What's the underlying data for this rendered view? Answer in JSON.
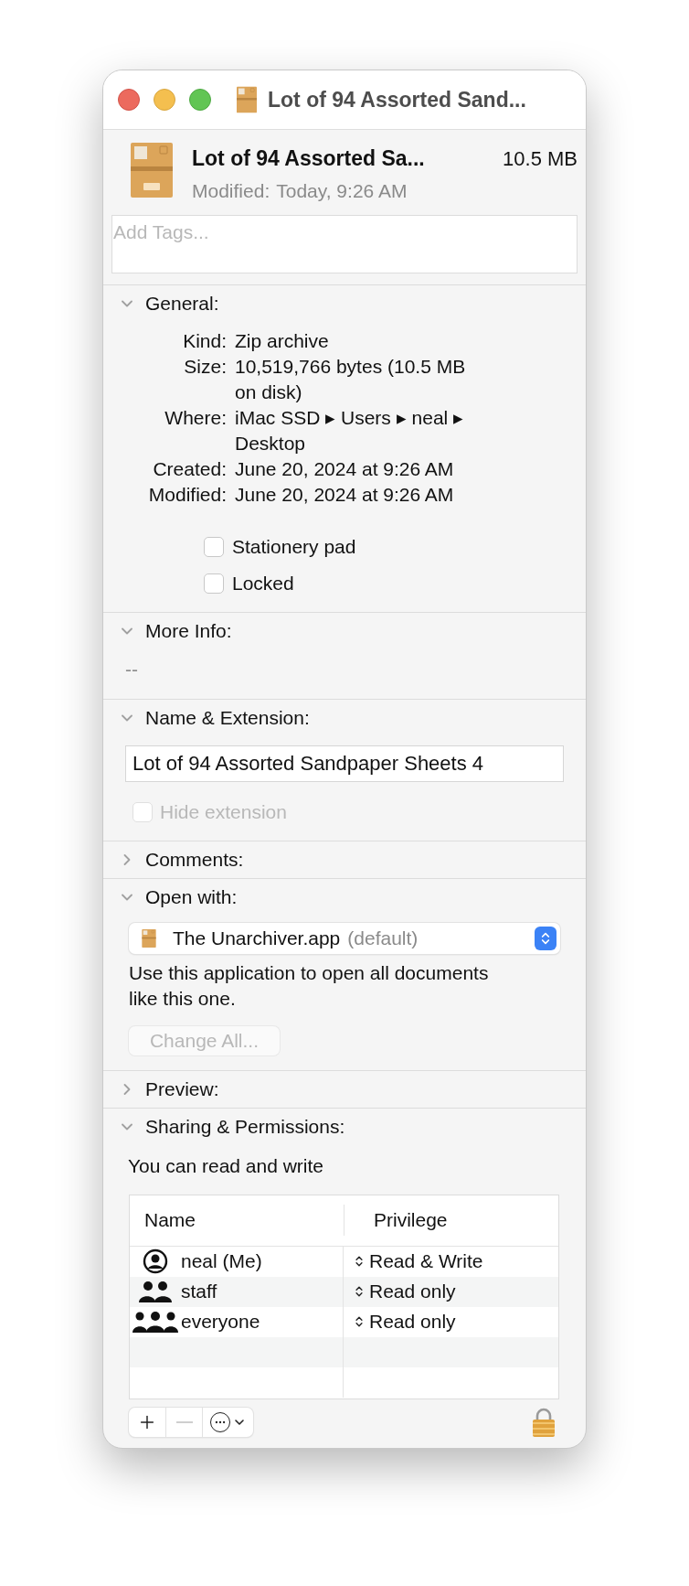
{
  "window": {
    "title": "Lot of 94 Assorted Sand..."
  },
  "header": {
    "name": "Lot of 94 Assorted Sa...",
    "size": "10.5 MB",
    "modified_label": "Modified:",
    "modified_value": "Today, 9:26 AM"
  },
  "tags": {
    "placeholder": "Add Tags..."
  },
  "sections": [
    {
      "kind": "general",
      "title": "General:",
      "expanded": true,
      "rows": [
        {
          "label": "Kind:",
          "lines": [
            "Zip archive"
          ]
        },
        {
          "label": "Size:",
          "lines": [
            "10,519,766 bytes (10.5 MB",
            "on disk)"
          ]
        },
        {
          "label": "Where:",
          "lines": [
            "iMac SSD ▸ Users ▸ neal ▸",
            "Desktop"
          ]
        },
        {
          "label": "Created:",
          "lines": [
            "June 20, 2024 at 9:26 AM"
          ]
        },
        {
          "label": "Modified:",
          "lines": [
            "June 20, 2024 at 9:26 AM"
          ]
        }
      ],
      "checkboxes": [
        {
          "label": "Stationery pad",
          "checked": false
        },
        {
          "label": "Locked",
          "checked": false
        }
      ]
    },
    {
      "kind": "more_info",
      "title": "More Info:",
      "expanded": true,
      "text": "--"
    },
    {
      "kind": "name",
      "title": "Name & Extension:",
      "expanded": true,
      "value": "Lot of 94 Assorted Sandpaper Sheets 4",
      "hide_extension": {
        "label": "Hide extension",
        "checked": false,
        "disabled": true
      }
    },
    {
      "title": "Comments:",
      "expanded": false
    },
    {
      "kind": "open_with",
      "title": "Open with:",
      "expanded": true,
      "app": "The Unarchiver.app",
      "app_note": "(default)",
      "description": "Use this application to open all documents like this one.",
      "button": {
        "label": "Change All...",
        "disabled": true
      }
    },
    {
      "title": "Preview:",
      "expanded": false
    },
    {
      "kind": "sharing",
      "title": "Sharing & Permissions:",
      "expanded": true,
      "note": "You can read and write",
      "columns": [
        "Name",
        "Privilege"
      ],
      "rows": [
        {
          "kind": "user",
          "name": "neal (Me)",
          "privilege": "Read & Write"
        },
        {
          "kind": "group",
          "name": "staff",
          "privilege": "Read only"
        },
        {
          "kind": "everyone",
          "name": "everyone",
          "privilege": "Read only"
        }
      ],
      "toolbar": [
        {
          "kind": "add",
          "disabled": false
        },
        {
          "kind": "remove",
          "disabled": true
        },
        {
          "kind": "action",
          "disabled": false
        }
      ]
    }
  ]
}
